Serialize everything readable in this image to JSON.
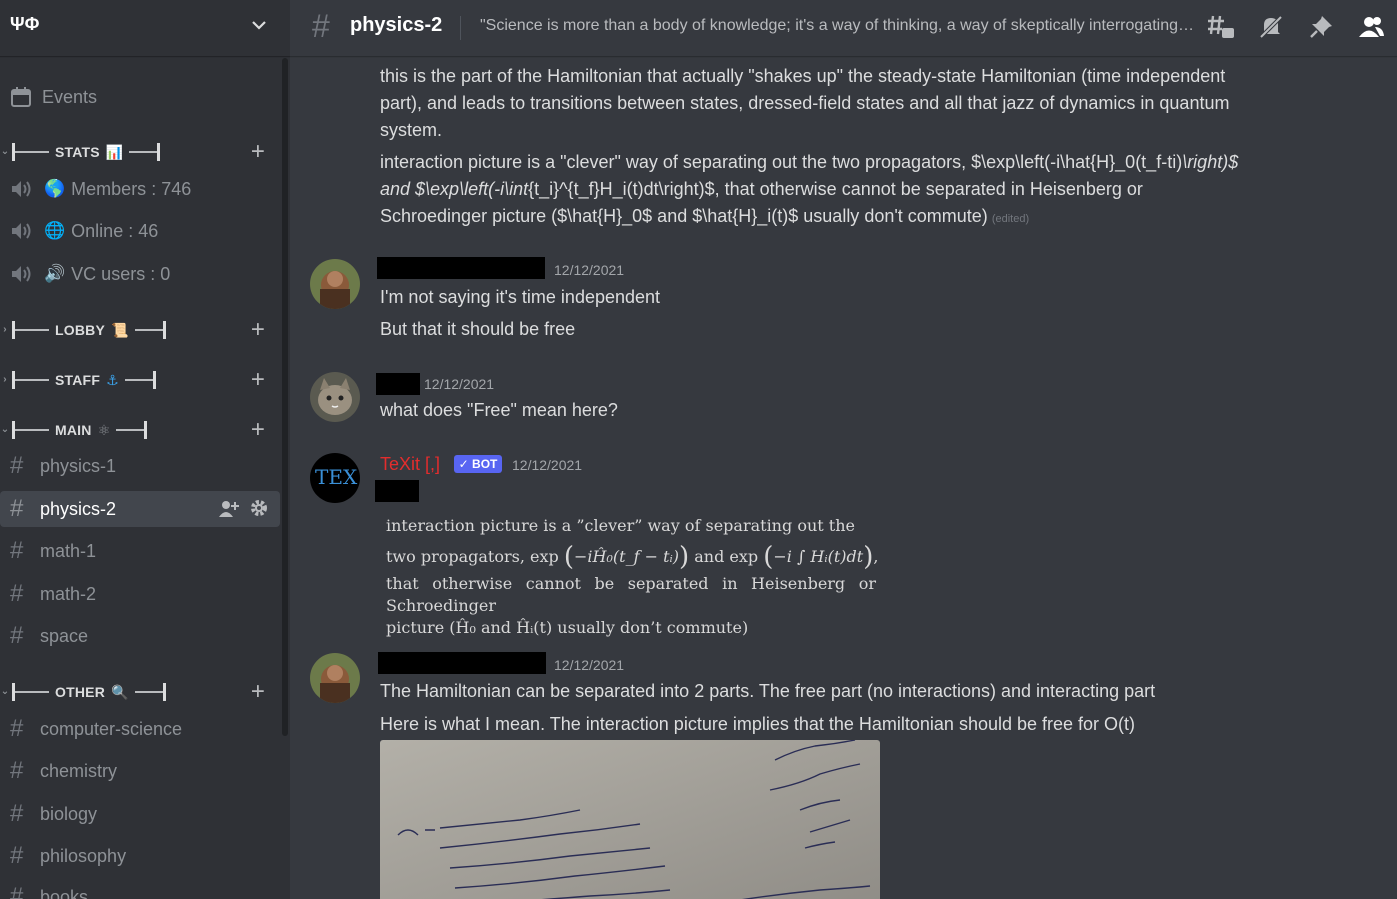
{
  "server": {
    "name": "ΨΦ"
  },
  "sidebar": {
    "events_label": "Events",
    "categories": {
      "stats": {
        "label": "STATS",
        "emoji": "📊"
      },
      "lobby": {
        "label": "LOBBY",
        "emoji": "📜"
      },
      "staff": {
        "label": "STAFF",
        "emoji": "⚓"
      },
      "main": {
        "label": "MAIN",
        "emoji": "⚛"
      },
      "other": {
        "label": "OTHER",
        "emoji": "🔍"
      }
    },
    "stat_channels": [
      {
        "emoji": "🌎",
        "label": "Members : 746"
      },
      {
        "emoji": "🌐",
        "label": "Online : 46"
      },
      {
        "emoji": "🔊",
        "label": "VC users : 0"
      }
    ],
    "main_channels": [
      "physics-1",
      "physics-2",
      "math-1",
      "math-2",
      "space"
    ],
    "other_channels": [
      "computer-science",
      "chemistry",
      "biology",
      "philosophy",
      "books"
    ]
  },
  "channel": {
    "name": "physics-2",
    "topic": "\"Science is more than a body of knowledge; it's a way of thinking, a way of skeptically interrogating the universe with a fine understanding of human fallibility.\""
  },
  "messages": {
    "m1": {
      "line1": "this is the part of the Hamiltonian that actually \"shakes up\" the steady-state Hamiltonian (time independent",
      "line2": "part), and leads to transitions between states, dressed-field states and all that jazz of dynamics in quantum",
      "line3": "system.",
      "line4a": "interaction picture is a \"clever\" way of separating out the two propagators, $\\exp\\left(-i\\hat{H}_0(t_f-ti)",
      "line4b": "\\right)$",
      "line5a": "and $\\exp\\left(-i\\int",
      "line5b": "{t_i}^{t_f}H_i(t)dt\\right)$, that otherwise cannot be separated in Heisenberg or",
      "line6": "Schroedinger picture ($\\hat{H}_0$ and $\\hat{H}_i(t)$ usually don't commute)",
      "edited": "(edited)"
    },
    "m2": {
      "timestamp": "12/12/2021",
      "line1": "I'm not saying it's time independent",
      "line2": "But that it should be free"
    },
    "m3": {
      "timestamp": "12/12/2021",
      "line1": "what does \"Free\" mean here?"
    },
    "m4": {
      "author": "TeXit [,]",
      "badge": "✓ BOT",
      "timestamp": "12/12/2021",
      "avatar_text": "TEX",
      "render_line1": "interaction picture is a ”clever” way of separating out the",
      "render_line2a": "two propagators, exp",
      "render_line2b": "−iĤ₀(t_f − tᵢ)",
      "render_line2c": "and exp",
      "render_line2d": "−i ∫",
      "render_line2e": "Hᵢ(t)dt",
      "render_line3": "that otherwise cannot be separated in Heisenberg or Schroedinger",
      "render_line4": "picture (Ĥ₀ and Ĥᵢ(t) usually don’t commute)"
    },
    "m5": {
      "timestamp": "12/12/2021",
      "line1": "The Hamiltonian can be separated into 2 parts. The free part (no interactions) and interacting part",
      "line2": "Here is what I mean. The interaction picture implies that the Hamiltonian should be free for O(t)"
    }
  },
  "colors": {
    "background": "#36393f",
    "sidebar": "#2f3136",
    "bot_name": "#e22d2d",
    "bot_badge": "#5865f2"
  },
  "icons": [
    "server-dropdown-chevron",
    "calendar-icon",
    "speaker-icon",
    "hash-icon",
    "threads-icon",
    "mute-bell-icon",
    "pin-icon",
    "members-icon",
    "add-member-icon",
    "gear-icon"
  ]
}
